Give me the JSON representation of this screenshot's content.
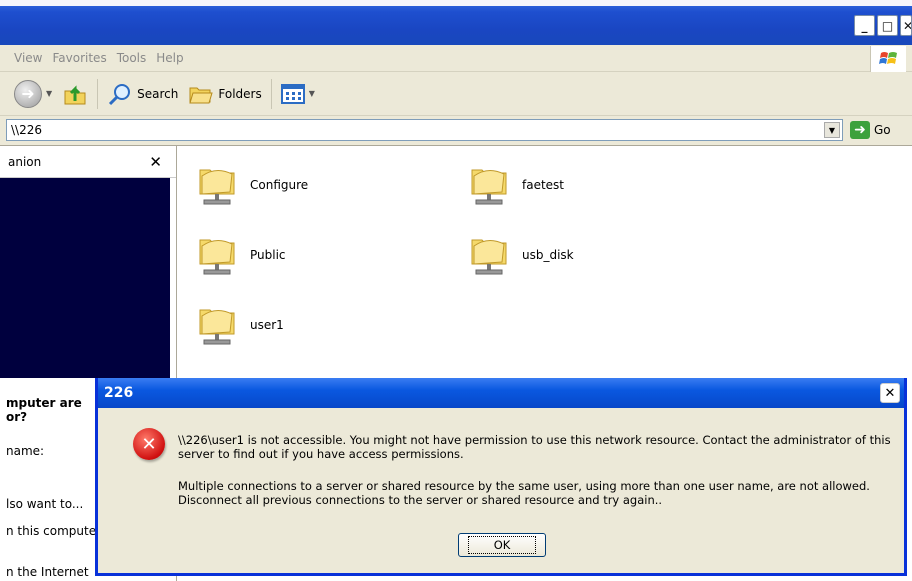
{
  "menu": {
    "items": [
      "View",
      "Favorites",
      "Tools",
      "Help"
    ]
  },
  "toolbar": {
    "search_label": "Search",
    "folders_label": "Folders"
  },
  "address": {
    "value": "\\\\226",
    "go_label": "Go"
  },
  "left_pane": {
    "header": "anion",
    "question_line1": "mputer are",
    "question_line2": "or?",
    "name_label": "name:",
    "also_want": "lso want to...",
    "this_computer": "n this compute",
    "internet": "n the Internet"
  },
  "folders": [
    {
      "name": "Configure"
    },
    {
      "name": "faetest"
    },
    {
      "name": "Public"
    },
    {
      "name": "usb_disk"
    },
    {
      "name": "user1"
    }
  ],
  "dialog": {
    "title": "226",
    "message1": "\\\\226\\user1 is not accessible. You might not have permission to use this network resource. Contact the administrator of this server to find out if you have access permissions.",
    "message2": "Multiple connections to a server or shared resource by the same user, using more than one user name, are not allowed. Disconnect all previous connections to the server or shared resource and try again..",
    "ok_label": "OK"
  },
  "colors": {
    "titlebar": "#1a46c2",
    "dialog_title": "#0a58e0",
    "error_red": "#d01010",
    "left_pane_dark": "#00003e"
  }
}
